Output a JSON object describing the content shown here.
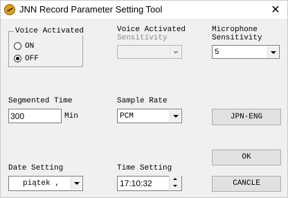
{
  "window": {
    "title": "JNN Record Parameter Setting Tool",
    "close_glyph": "✕"
  },
  "voice_activated": {
    "label": "Voice Activated",
    "on_label": "ON",
    "off_label": "OFF",
    "selected": "OFF"
  },
  "sensitivity": {
    "label_line1": "Voice Activated",
    "label_line2": "Sensitivity",
    "value": ""
  },
  "microphone": {
    "label_line1": "Microphone",
    "label_line2": "Sensitivity",
    "value": "5"
  },
  "segmented_time": {
    "label": "Segmented Time",
    "value": "300",
    "unit": "Min"
  },
  "sample_rate": {
    "label": "Sample Rate",
    "value": "PCM"
  },
  "jpn_eng_button": "JPN-ENG",
  "date_setting": {
    "label": "Date Setting",
    "value": "piątek   ,"
  },
  "time_setting": {
    "label": "Time Setting",
    "value": "17:10:32"
  },
  "ok_button": "OK",
  "cancel_button": "CANCLE"
}
